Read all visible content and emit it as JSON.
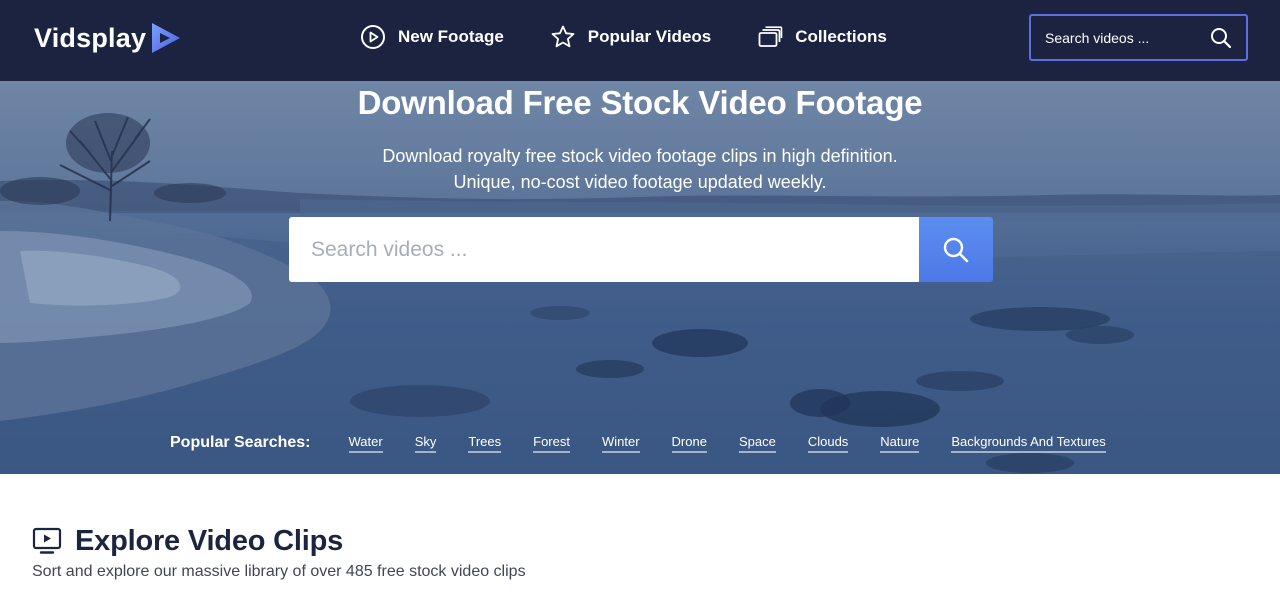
{
  "brand": {
    "name": "Vidsplay",
    "accent": "#5b6fe0",
    "nav_bg": "#1b2340"
  },
  "nav": {
    "links": [
      {
        "label": "New Footage",
        "icon": "play-circle-icon"
      },
      {
        "label": "Popular Videos",
        "icon": "star-icon"
      },
      {
        "label": "Collections",
        "icon": "collections-icon"
      }
    ],
    "search_placeholder": "Search videos ..."
  },
  "hero": {
    "title": "Download Free Stock Video Footage",
    "subtitle_line1": "Download royalty free stock video footage clips in high definition.",
    "subtitle_line2": "Unique, no-cost video footage updated weekly.",
    "search_placeholder": "Search videos ...",
    "popular_label": "Popular Searches:",
    "popular_tags": [
      "Water",
      "Sky",
      "Trees",
      "Forest",
      "Winter",
      "Drone",
      "Space",
      "Clouds",
      "Nature",
      "Backgrounds And Textures"
    ]
  },
  "explore": {
    "title": "Explore Video Clips",
    "subtitle": "Sort and explore our massive library of over 485 free stock video clips",
    "icon": "monitor-play-icon"
  }
}
